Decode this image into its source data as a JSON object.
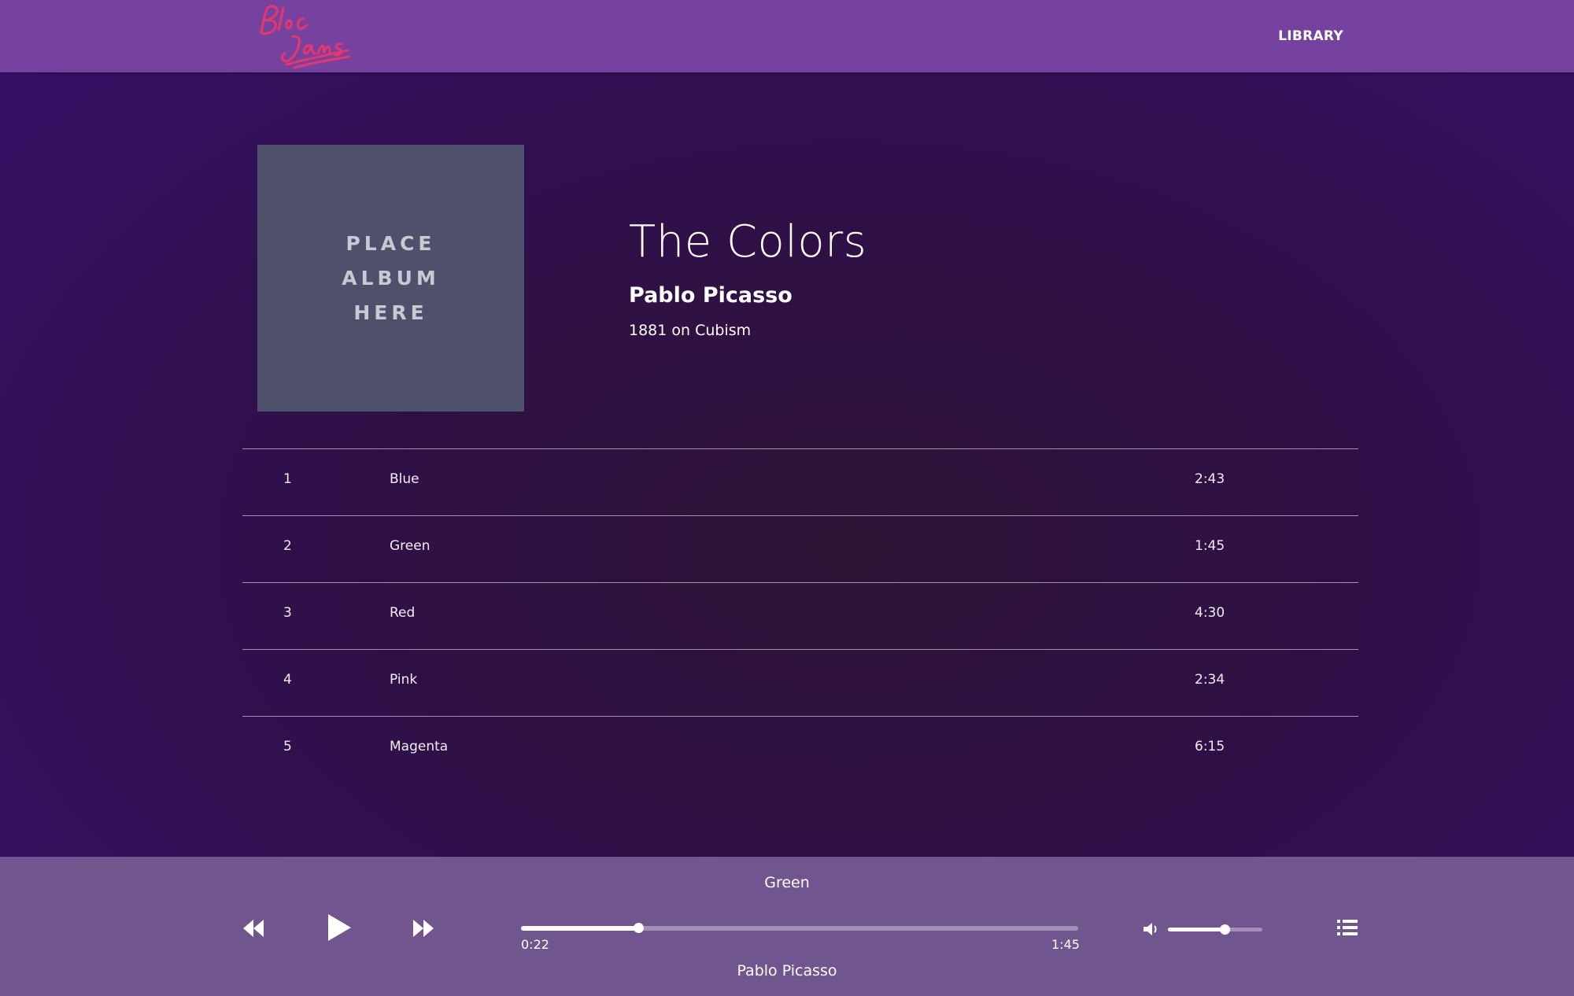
{
  "navbar": {
    "logo_text": "Bloc Jams",
    "library_label": "LIBRARY"
  },
  "album": {
    "art_placeholder": "PLACE ALBUM HERE",
    "title": "The Colors",
    "artist": "Pablo Picasso",
    "release_info": "1881 on Cubism"
  },
  "songs": [
    {
      "number": "1",
      "title": "Blue",
      "duration": "2:43"
    },
    {
      "number": "2",
      "title": "Green",
      "duration": "1:45"
    },
    {
      "number": "3",
      "title": "Red",
      "duration": "4:30"
    },
    {
      "number": "4",
      "title": "Pink",
      "duration": "2:34"
    },
    {
      "number": "5",
      "title": "Magenta",
      "duration": "6:15"
    }
  ],
  "player": {
    "song_title": "Green",
    "artist": "Pablo Picasso",
    "current_time": "0:22",
    "total_time": "1:45",
    "seek_fraction": 0.21,
    "volume_fraction": 0.6,
    "icons": {
      "previous": "rewind-icon",
      "play": "play-icon",
      "next": "fast-forward-icon",
      "volume": "volume-icon",
      "playlist": "list-icon"
    }
  },
  "colors": {
    "navbar": "#7542a0",
    "player_bar": "#71558f",
    "logo": "#e8356b",
    "background": "#2f1048"
  }
}
